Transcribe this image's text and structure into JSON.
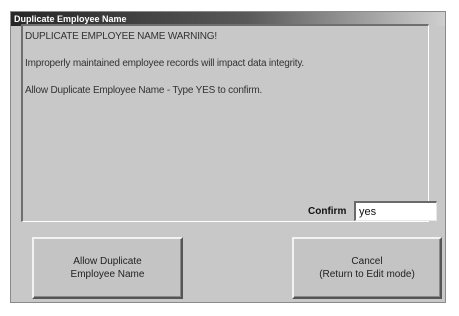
{
  "window": {
    "title": "Duplicate Employee Name"
  },
  "message": {
    "line1": "DUPLICATE EMPLOYEE NAME WARNING!",
    "line2": "Improperly maintained employee records will impact data integrity.",
    "line3": "Allow Duplicate Employee Name - Type YES to confirm."
  },
  "confirm": {
    "label": "Confirm",
    "value": "yes"
  },
  "buttons": {
    "allow": {
      "line1": "Allow Duplicate",
      "line2": "Employee Name"
    },
    "cancel": {
      "line1": "Cancel",
      "line2": "(Return to Edit mode)"
    }
  }
}
